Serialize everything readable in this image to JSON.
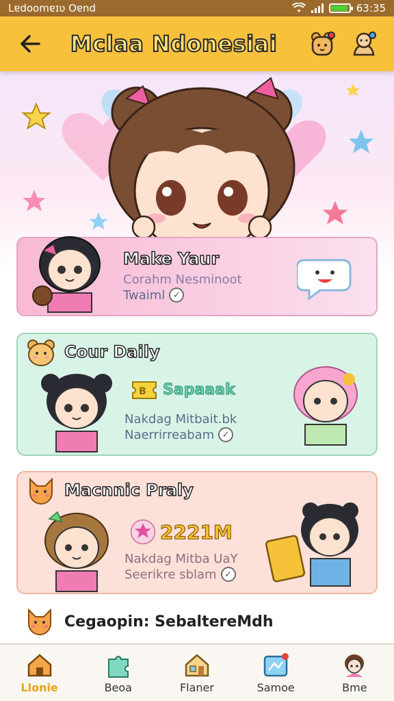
{
  "status_bar": {
    "carrier": "Lɐdoomɐɪʋ Oɐnd",
    "time": "63:35"
  },
  "app_bar": {
    "title": "Mclaa Ndonesiai",
    "back_icon": "arrow-left-icon",
    "notification_icon": "bear-notification-icon",
    "profile_icon": "profile-notification-icon",
    "accent": "#f7c13c"
  },
  "cards": [
    {
      "title": "Make Yaur",
      "subtitle": "Corahm Nesminoot",
      "status": "Twaiml"
    },
    {
      "title": "Cour Daily",
      "reward_value": "Sapaaak",
      "line1": "Nakdag Mitbait.bk",
      "line2": "Naerrirreabam"
    },
    {
      "title": "Macnnic Praly",
      "reward_value": "2221M",
      "line1": "Nakdag Mitba UaY",
      "line2": "Seerikre sblam"
    }
  ],
  "info_row": {
    "text": "Cegaopin: SebaltereMdh"
  },
  "bottom_nav": [
    {
      "label": "Llonie",
      "icon": "home-icon",
      "active": true
    },
    {
      "label": "Beoa",
      "icon": "puzzle-icon",
      "active": false
    },
    {
      "label": "Flaner",
      "icon": "house-icon",
      "active": false
    },
    {
      "label": "Samoe",
      "icon": "gift-icon",
      "active": false
    },
    {
      "label": "Bme",
      "icon": "avatar-icon",
      "active": false
    }
  ]
}
